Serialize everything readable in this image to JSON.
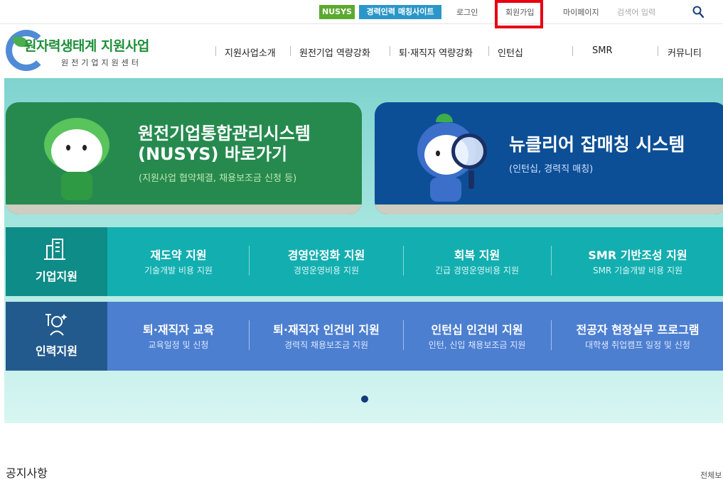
{
  "utility": {
    "nusys_label": "NUSYS",
    "matching_site_label": "경력인력 매칭사이트",
    "login_label": "로그인",
    "signup_label": "회원가입",
    "mypage_label": "마이페이지",
    "search_placeholder": "검색어 입력",
    "search_icon": "search-icon"
  },
  "logo": {
    "title": "원자력생태계 지원사업",
    "subtitle": "원전기업지원센터"
  },
  "gnb": [
    {
      "label": "지원사업소개"
    },
    {
      "label": "원전기업 역량강화"
    },
    {
      "label": "퇴·재직자 역량강화"
    },
    {
      "label": "인턴십"
    },
    {
      "label": "SMR"
    },
    {
      "label": "커뮤니티"
    }
  ],
  "cards": {
    "nusys": {
      "title_line1": "원전기업통합관리시스템",
      "title_line2": "(NUSYS) 바로가기",
      "sub": "(지원사업 협약체결, 채용보조금 신청 등)"
    },
    "matching": {
      "title": "뉴클리어 잡매칭 시스템",
      "sub": "(인턴십, 경력직 매칭)"
    }
  },
  "rows": {
    "company": {
      "label": "기업지원",
      "icon": "building-icon",
      "items": [
        {
          "title": "재도약 지원",
          "sub": "기술개발 비용 지원"
        },
        {
          "title": "경영안정화 지원",
          "sub": "경영운영비용 지원"
        },
        {
          "title": "회복 지원",
          "sub": "긴급 경영운영비용 지원"
        },
        {
          "title": "SMR 기반조성 지원",
          "sub": "SMR 기술개발 비용 지원"
        }
      ]
    },
    "workforce": {
      "label": "인력지원",
      "icon": "worker-icon",
      "items": [
        {
          "title": "퇴·재직자 교육",
          "sub": "교육일정 및 신청"
        },
        {
          "title": "퇴·재직자 인건비 지원",
          "sub": "경력직 채용보조금 지원"
        },
        {
          "title": "인턴십 인건비 지원",
          "sub": "인턴, 신입 채용보조금 지원"
        },
        {
          "title": "전공자 현장실무 프로그램",
          "sub": "대학생 취업캠프 일정 및 신청"
        }
      ]
    }
  },
  "notice": {
    "title": "공지사항",
    "more_label": "전체보"
  },
  "colors": {
    "nusys_green": "#268a4f",
    "matching_blue": "#0d4f96",
    "company_teal": "#13aeb0",
    "workforce_blue": "#4d7fd0",
    "highlight_red": "#e60012"
  }
}
